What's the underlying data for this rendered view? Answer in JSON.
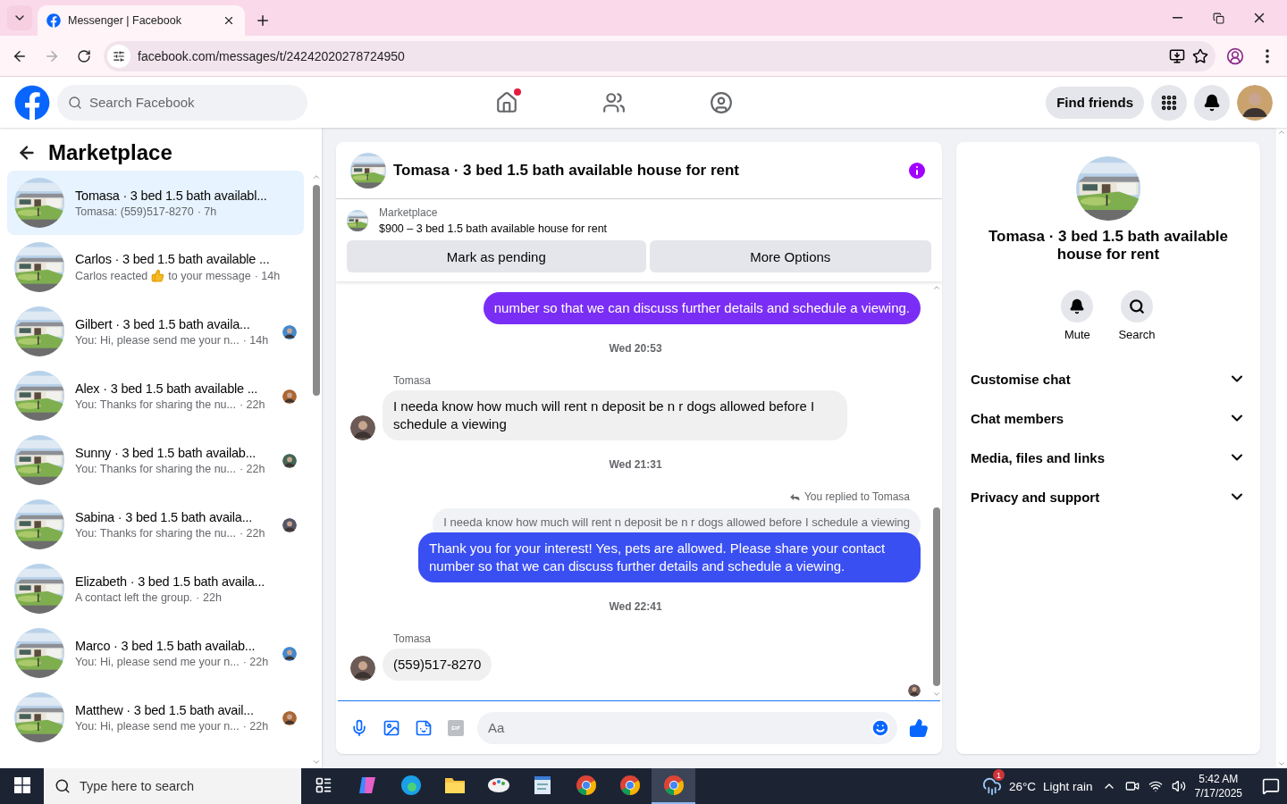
{
  "browser": {
    "tab": {
      "title": "Messenger | Facebook",
      "selected": true
    },
    "url": "facebook.com/messages/t/24242020278724950",
    "forward_disabled": true
  },
  "topbar": {
    "search": {
      "placeholder": "Search Facebook"
    },
    "home_notification": true,
    "find_friends": "Find friends"
  },
  "sidebar": {
    "title": "Marketplace",
    "conversations": [
      {
        "title": "Tomasa · 3 bed 1.5 bath availabl...",
        "preview": "Tomasa: (559)517-8270",
        "time": "· 7h",
        "selected": true,
        "seen": false
      },
      {
        "title": "Carlos · 3 bed 1.5 bath available ...",
        "preview": "Carlos reacted",
        "reacted": true,
        "preview_after": "to your message",
        "time": "· 14h",
        "selected": false,
        "seen": false
      },
      {
        "title": "Gilbert · 3 bed 1.5 bath availa...",
        "preview": "You: Hi, please send me your n...",
        "time": "· 14h",
        "selected": false,
        "seen": true
      },
      {
        "title": "Alex · 3 bed 1.5 bath available ...",
        "preview": "You: Thanks for sharing the nu...",
        "time": "· 22h",
        "selected": false,
        "seen": true
      },
      {
        "title": "Sunny · 3 bed 1.5 bath availab...",
        "preview": "You: Thanks for sharing the nu...",
        "time": "· 22h",
        "selected": false,
        "seen": true
      },
      {
        "title": "Sabina · 3 bed 1.5 bath availa...",
        "preview": "You: Thanks for sharing the nu...",
        "time": "· 22h",
        "selected": false,
        "seen": true
      },
      {
        "title": "Elizabeth · 3 bed 1.5 bath availa...",
        "preview": "A contact left the group.",
        "time": "· 22h",
        "selected": false,
        "seen": false
      },
      {
        "title": "Marco · 3 bed 1.5 bath availab...",
        "preview": "You: Hi, please send me your n...",
        "time": "· 22h",
        "selected": false,
        "seen": true
      },
      {
        "title": "Matthew · 3 bed 1.5 bath avail...",
        "preview": "You: Hi, please send me your n...",
        "time": "· 22h",
        "selected": false,
        "seen": true
      }
    ]
  },
  "chat": {
    "title": "Tomasa · 3 bed 1.5 bath available house for rent",
    "listing": {
      "source": "Marketplace",
      "summary": "$900 – 3 bed 1.5 bath available house for rent",
      "actions": [
        "Mark as pending",
        "More Options"
      ]
    },
    "messages": [
      {
        "kind": "outgoing",
        "text": "number so that we can discuss further details and schedule a viewing.",
        "color": "#7a2ef5"
      },
      {
        "kind": "time",
        "text": "Wed 20:53"
      },
      {
        "kind": "incoming",
        "sender": "Tomasa",
        "text": "I needa know how much will rent n deposit be n r dogs allowed before I schedule a viewing"
      },
      {
        "kind": "time",
        "text": "Wed 21:31"
      },
      {
        "kind": "reply",
        "label": "You replied to Tomasa",
        "quote": "I needa know how much will rent n deposit be n r dogs allowed before I schedule a viewing",
        "text": "Thank you for your interest! Yes, pets are allowed. Please share your contact number so that we can discuss further details and schedule a viewing.",
        "color": "#3a4ff2"
      },
      {
        "kind": "time",
        "text": "Wed 22:41"
      },
      {
        "kind": "incoming",
        "sender": "Tomasa",
        "text": "(559)517-8270"
      }
    ],
    "seen_marker": true,
    "composer": {
      "placeholder": "Aa"
    }
  },
  "details": {
    "title": "Tomasa · 3 bed 1.5 bath available house for rent",
    "actions": [
      {
        "kind": "mute",
        "label": "Mute"
      },
      {
        "kind": "search",
        "label": "Search"
      }
    ],
    "sections": [
      {
        "label": "Customise chat",
        "expanded": false
      },
      {
        "label": "Chat members",
        "expanded": false
      },
      {
        "label": "Media, files and links",
        "expanded": false
      },
      {
        "label": "Privacy and support",
        "expanded": false
      }
    ]
  },
  "taskbar": {
    "search": {
      "placeholder": "Type here to search"
    },
    "apps": [
      {
        "kind": "task-view",
        "selected": false
      },
      {
        "kind": "copilot",
        "selected": false
      },
      {
        "kind": "edge",
        "selected": false
      },
      {
        "kind": "files",
        "selected": false
      },
      {
        "kind": "paint",
        "selected": false
      },
      {
        "kind": "notepad",
        "selected": false
      },
      {
        "kind": "chrome",
        "selected": false
      },
      {
        "kind": "chrome",
        "selected": false
      },
      {
        "kind": "chrome",
        "selected": true
      }
    ],
    "weather": {
      "badge": "1",
      "temperature": "26°C",
      "condition": "Light rain"
    },
    "clock": {
      "time": "5:42 AM",
      "date": "7/17/2025"
    }
  }
}
